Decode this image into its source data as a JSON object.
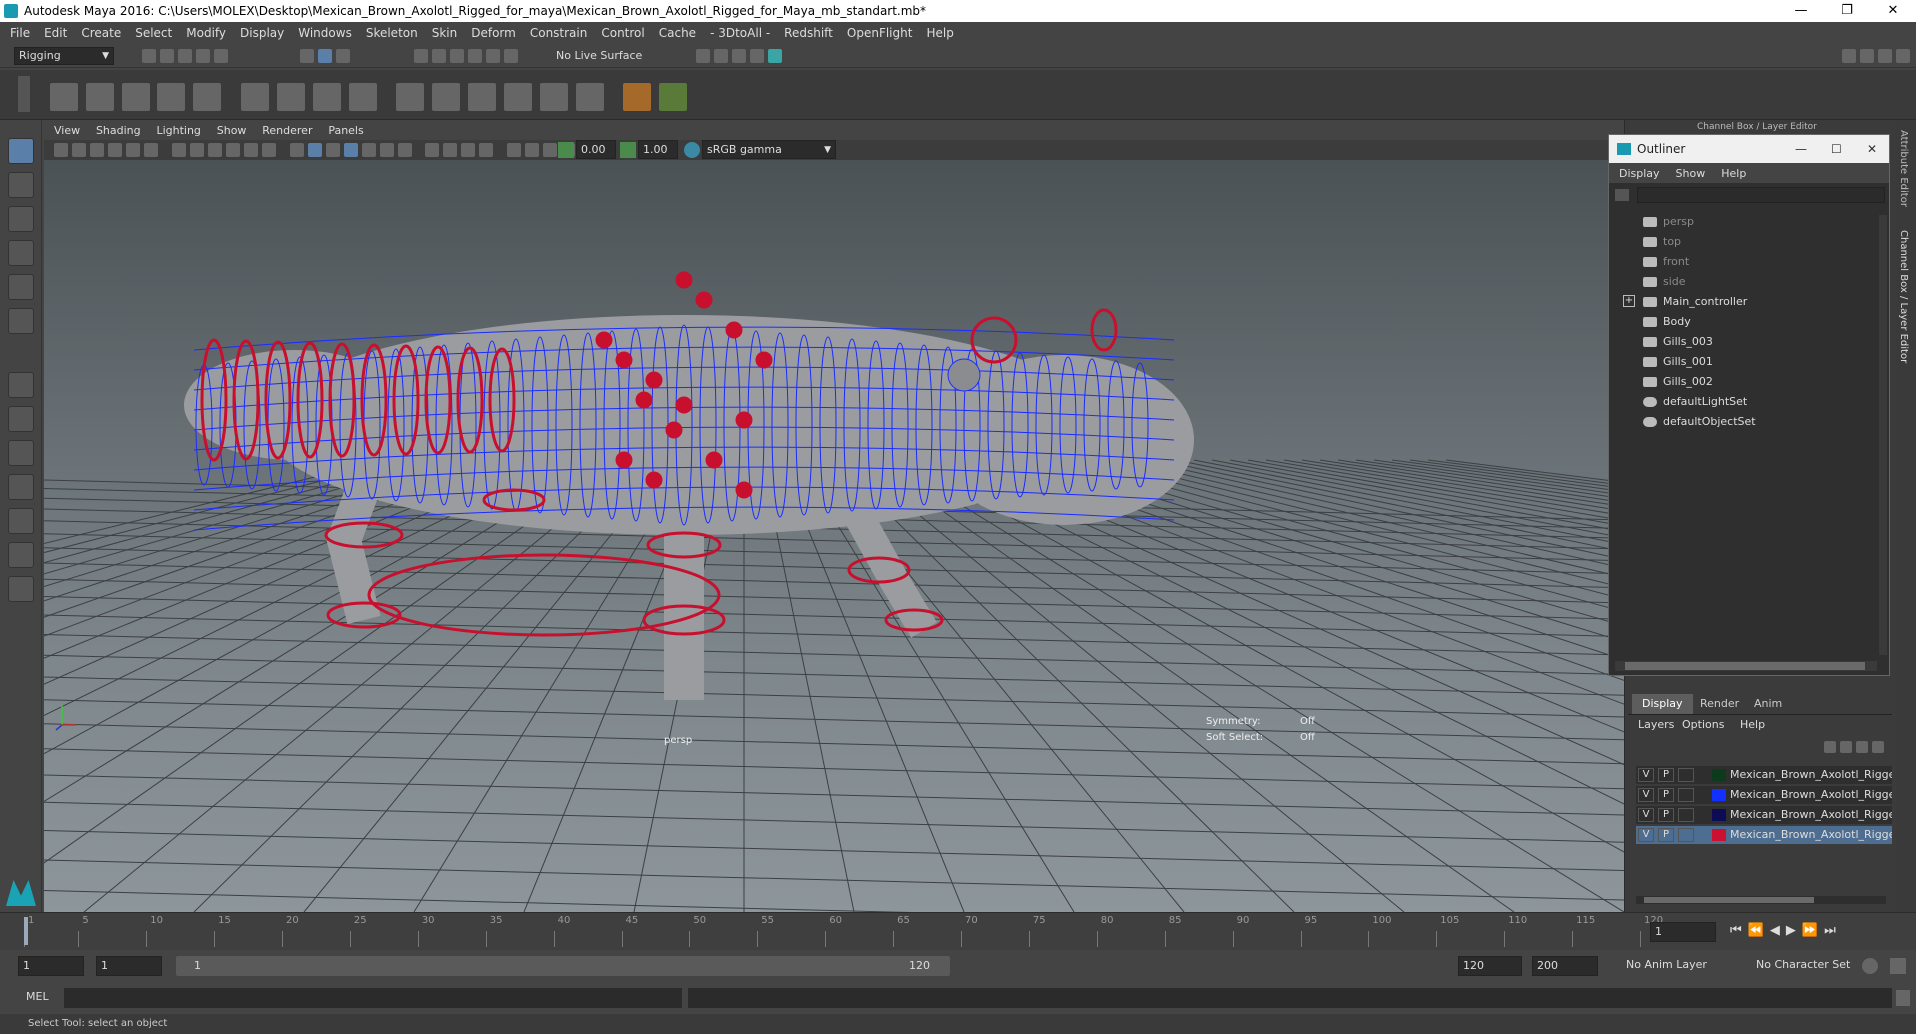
{
  "window": {
    "title": "Autodesk Maya 2016: C:\\Users\\MOLEX\\Desktop\\Mexican_Brown_Axolotl_Rigged_for_maya\\Mexican_Brown_Axolotl_Rigged_for_Maya_mb_standart.mb*"
  },
  "menus": [
    "File",
    "Edit",
    "Create",
    "Select",
    "Modify",
    "Display",
    "Windows",
    "Skeleton",
    "Skin",
    "Deform",
    "Constrain",
    "Control",
    "Cache",
    "- 3DtoAll -",
    "Redshift",
    "OpenFlight",
    "Help"
  ],
  "status": {
    "mode": "Rigging",
    "live_surface": "No Live Surface"
  },
  "viewport": {
    "menus": [
      "View",
      "Shading",
      "Lighting",
      "Show",
      "Renderer",
      "Panels"
    ],
    "near_value": "0.00",
    "far_value": "1.00",
    "color_space": "sRGB gamma",
    "camera_label": "persp",
    "hud": {
      "symmetry_label": "Symmetry:",
      "symmetry_value": "Off",
      "soft_select_label": "Soft Select:",
      "soft_select_value": "Off"
    }
  },
  "right_header": "Channel Box / Layer Editor",
  "outliner": {
    "title": "Outliner",
    "menus": [
      "Display",
      "Show",
      "Help"
    ],
    "items": [
      "persp",
      "top",
      "front",
      "side",
      "Main_controller",
      "Body",
      "Gills_003",
      "Gills_001",
      "Gills_002",
      "defaultLightSet",
      "defaultObjectSet"
    ]
  },
  "side_tabs": [
    "Attribute Editor",
    "Channel Box / Layer Editor"
  ],
  "layer_editor": {
    "tabs": [
      "Display",
      "Render",
      "Anim"
    ],
    "menus": [
      "Layers",
      "Options",
      "Help"
    ],
    "visible_flag": "V",
    "playback_flag": "P",
    "layers": [
      {
        "name": "Mexican_Brown_Axolotl_Rigged_",
        "color": "#0b3b1a"
      },
      {
        "name": "Mexican_Brown_Axolotl_Rigged",
        "color": "#1230ff"
      },
      {
        "name": "Mexican_Brown_Axolotl_Rigged_",
        "color": "#0c0c55"
      },
      {
        "name": "Mexican_Brown_Axolotl_Rigged",
        "color": "#cc1030"
      }
    ]
  },
  "timeline": {
    "ticks": [
      "1",
      "5",
      "10",
      "15",
      "20",
      "25",
      "30",
      "35",
      "40",
      "45",
      "50",
      "55",
      "60",
      "65",
      "70",
      "75",
      "80",
      "85",
      "90",
      "95",
      "100",
      "105",
      "110",
      "115",
      "120"
    ],
    "current_frame": "1"
  },
  "range": {
    "start": "1",
    "start_inner": "1",
    "slider_start": "1",
    "slider_end": "120",
    "end_inner": "120",
    "end": "200",
    "anim_layer": "No Anim Layer",
    "character_set": "No Character Set"
  },
  "cmd": {
    "label": "MEL"
  },
  "help_line": "Select Tool: select an object",
  "colors": {
    "wire": "#1a2cff",
    "controls": "#c8102e",
    "mesh": "#9a9ca0"
  }
}
